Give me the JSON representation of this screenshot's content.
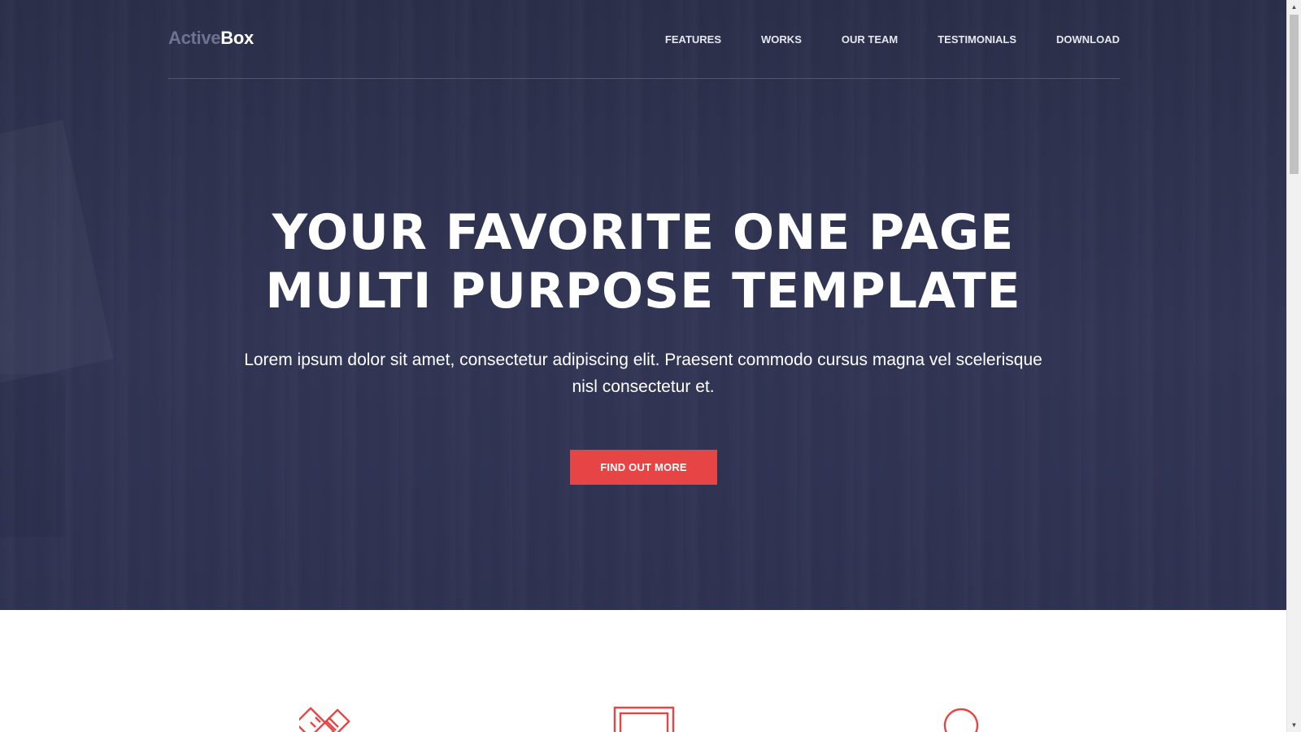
{
  "nav": {
    "logo_part1": "Active",
    "logo_part2": "Box",
    "items": [
      {
        "label": "FEATURES"
      },
      {
        "label": "WORKS"
      },
      {
        "label": "OUR TEAM"
      },
      {
        "label": "TESTIMONIALS"
      },
      {
        "label": "DOWNLOAD"
      }
    ]
  },
  "hero": {
    "headline_line1": "YOUR FAVORITE ONE PAGE",
    "headline_line2": "MULTI PURPOSE TEMPLATE",
    "subtext": "Lorem ipsum dolor sit amet, consectetur adipiscing elit. Praesent commodo cursus magna vel scelerisque nisl consectetur et.",
    "cta_label": "FIND OUT MORE"
  },
  "features": {
    "icons": [
      {
        "name": "pencil-ruler-icon"
      },
      {
        "name": "monitor-icon"
      },
      {
        "name": "circle-icon"
      }
    ]
  },
  "colors": {
    "hero_bg": "#2e3250",
    "accent": "#e74545",
    "logo_muted": "#6f7391",
    "white": "#ffffff"
  }
}
